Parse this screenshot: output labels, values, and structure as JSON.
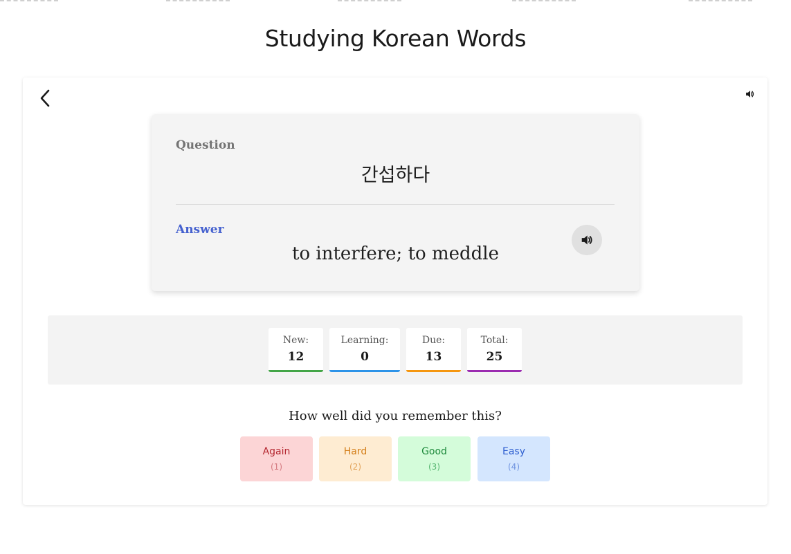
{
  "page": {
    "title": "Studying Korean Words"
  },
  "controls": {
    "back_icon": "chevron-left-icon",
    "sound_icon": "speaker-icon"
  },
  "card": {
    "question_label": "Question",
    "question_text": "간섭하다",
    "answer_label": "Answer",
    "answer_text": "to interfere; to meddle",
    "audio_icon": "speaker-icon"
  },
  "stats": [
    {
      "label": "New:",
      "value": "12",
      "color": "#43a547"
    },
    {
      "label": "Learning:",
      "value": "0",
      "color": "#2d93e8"
    },
    {
      "label": "Due:",
      "value": "13",
      "color": "#f5960f"
    },
    {
      "label": "Total:",
      "value": "25",
      "color": "#9b2bb0"
    }
  ],
  "rating": {
    "prompt": "How well did you remember this?",
    "buttons": [
      {
        "label": "Again",
        "key": "(1)",
        "bg": "#fcd5d6",
        "fg": "#b4262f",
        "key_fg": "#d47a80"
      },
      {
        "label": "Hard",
        "key": "(2)",
        "bg": "#feecd2",
        "fg": "#d4801c",
        "key_fg": "#e2a35a"
      },
      {
        "label": "Good",
        "key": "(3)",
        "bg": "#d4fcda",
        "fg": "#1e8a3c",
        "key_fg": "#58b772"
      },
      {
        "label": "Easy",
        "key": "(4)",
        "bg": "#d4e6fe",
        "fg": "#2e5fd0",
        "key_fg": "#6f93e0"
      }
    ]
  }
}
